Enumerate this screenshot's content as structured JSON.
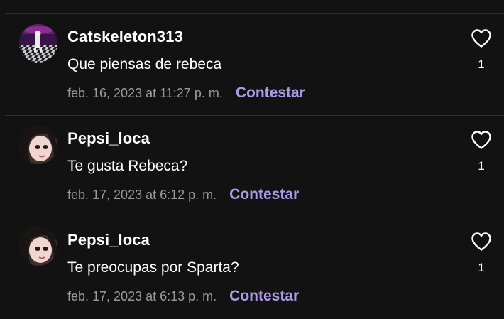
{
  "comments": [
    {
      "username": "Catskeleton313",
      "text": "Que piensas de rebeca",
      "timestamp": "feb. 16, 2023 at 11:27 p. m.",
      "reply_label": "Contestar",
      "likes": "1",
      "avatar": "avatar-checkered-room"
    },
    {
      "username": "Pepsi_loca",
      "text": "Te gusta Rebeca?",
      "timestamp": "feb. 17, 2023 at 6:12 p. m.",
      "reply_label": "Contestar",
      "likes": "1",
      "avatar": "avatar-dark-hair-face"
    },
    {
      "username": "Pepsi_loca",
      "text": "Te preocupas por Sparta?",
      "timestamp": "feb. 17, 2023 at 6:13 p. m.",
      "reply_label": "Contestar",
      "likes": "1",
      "avatar": "avatar-dark-hair-face"
    }
  ],
  "colors": {
    "background": "#121212",
    "divider": "#2e2e2e",
    "text": "#ffffff",
    "muted": "#9a9a9a",
    "accent": "#a99be6"
  },
  "icons": {
    "like": "heart-outline-icon"
  }
}
